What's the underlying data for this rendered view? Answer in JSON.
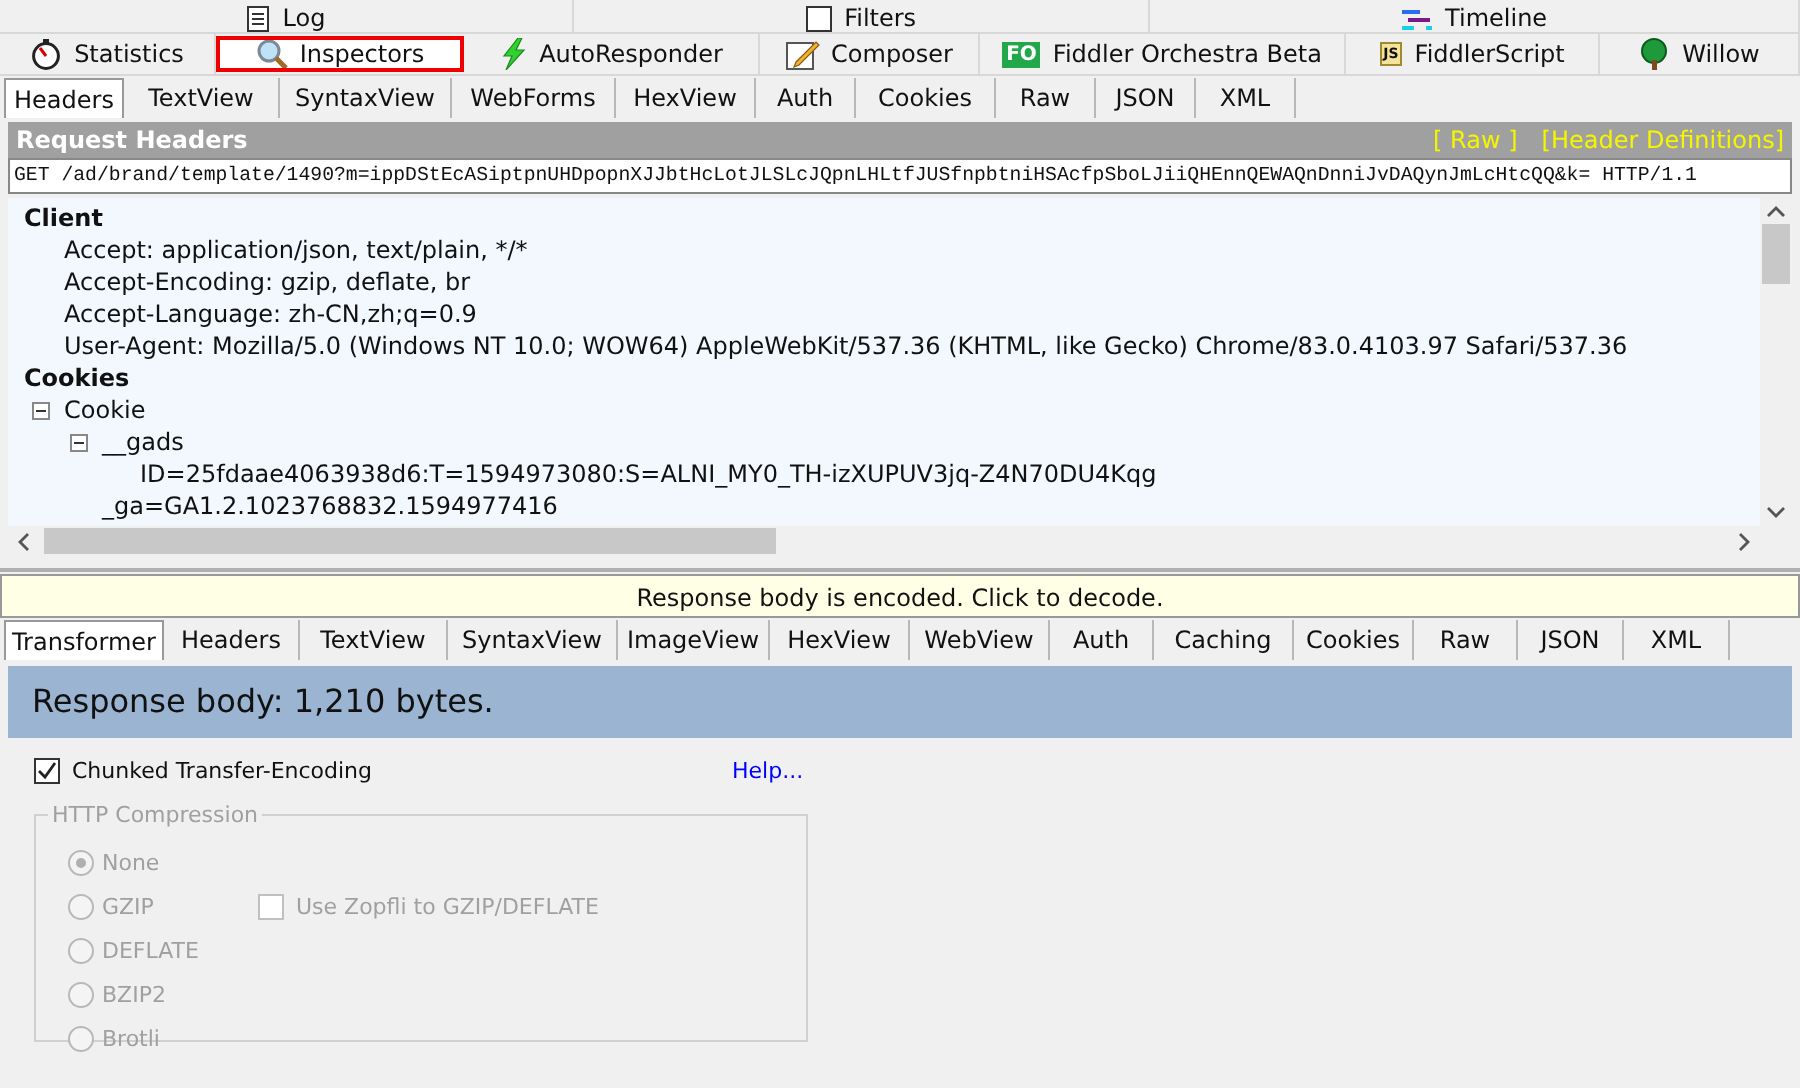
{
  "top_tabs": [
    {
      "label": "Log"
    },
    {
      "label": "Filters"
    },
    {
      "label": "Timeline"
    }
  ],
  "main_tabs": [
    {
      "label": "Statistics",
      "selected": false
    },
    {
      "label": "Inspectors",
      "selected": true
    },
    {
      "label": "AutoResponder",
      "selected": false
    },
    {
      "label": "Composer",
      "selected": false
    },
    {
      "label": "Fiddler Orchestra Beta",
      "badge": "FO",
      "selected": false
    },
    {
      "label": "FiddlerScript",
      "badge": "JS",
      "selected": false
    },
    {
      "label": "Willow",
      "selected": false
    }
  ],
  "request_tabs": [
    {
      "label": "Headers",
      "selected": true
    },
    {
      "label": "TextView",
      "selected": false
    },
    {
      "label": "SyntaxView",
      "selected": false
    },
    {
      "label": "WebForms",
      "selected": false
    },
    {
      "label": "HexView",
      "selected": false
    },
    {
      "label": "Auth",
      "selected": false
    },
    {
      "label": "Cookies",
      "selected": false
    },
    {
      "label": "Raw",
      "selected": false
    },
    {
      "label": "JSON",
      "selected": false
    },
    {
      "label": "XML",
      "selected": false
    }
  ],
  "request_headers": {
    "title": "Request Headers",
    "links": [
      "[ Raw ]",
      "[Header Definitions]"
    ],
    "request_line": "GET /ad/brand/template/1490?m=ippDStEcASiptpnUHDpopnXJJbtHcLotJLSLcJQpnLHLtfJUSfnpbtniHSAcfpSboLJiiQHEnnQEWAQnDnniJvDAQynJmLcHtcQQ&k= HTTP/1.1",
    "sections": [
      {
        "title": "Client",
        "items": [
          {
            "label": "Accept: application/json, text/plain, */*"
          },
          {
            "label": "Accept-Encoding: gzip, deflate, br"
          },
          {
            "label": "Accept-Language: zh-CN,zh;q=0.9"
          },
          {
            "label": "User-Agent: Mozilla/5.0 (Windows NT 10.0; WOW64) AppleWebKit/537.36 (KHTML, like Gecko) Chrome/83.0.4103.97 Safari/537.36"
          }
        ]
      },
      {
        "title": "Cookies",
        "items": [
          {
            "label": "Cookie",
            "expanded": true,
            "children": [
              {
                "label": "__gads",
                "expanded": true,
                "children": [
                  {
                    "label": "ID=25fdaae4063938d6:T=1594973080:S=ALNI_MY0_TH-izXUPUV3jq-Z4N70DU4Kqg"
                  }
                ]
              },
              {
                "label": "_ga=GA1.2.1023768832.1594977416"
              }
            ]
          }
        ]
      }
    ]
  },
  "decode_bar": "Response body is encoded. Click to decode.",
  "response_tabs": [
    {
      "label": "Transformer",
      "selected": true
    },
    {
      "label": "Headers",
      "selected": false
    },
    {
      "label": "TextView",
      "selected": false
    },
    {
      "label": "SyntaxView",
      "selected": false
    },
    {
      "label": "ImageView",
      "selected": false
    },
    {
      "label": "HexView",
      "selected": false
    },
    {
      "label": "WebView",
      "selected": false
    },
    {
      "label": "Auth",
      "selected": false
    },
    {
      "label": "Caching",
      "selected": false
    },
    {
      "label": "Cookies",
      "selected": false
    },
    {
      "label": "Raw",
      "selected": false
    },
    {
      "label": "JSON",
      "selected": false
    },
    {
      "label": "XML",
      "selected": false
    }
  ],
  "response_body": "Response body: 1,210 bytes.",
  "chunked": {
    "label": "Chunked Transfer-Encoding",
    "checked": true
  },
  "help_link": "Help...",
  "compression": {
    "title": "HTTP Compression",
    "disabled": true,
    "options": [
      {
        "label": "None",
        "selected": true
      },
      {
        "label": "GZIP",
        "selected": false
      },
      {
        "label": "DEFLATE",
        "selected": false
      },
      {
        "label": "BZIP2",
        "selected": false
      },
      {
        "label": "Brotli",
        "selected": false
      }
    ],
    "zopfli": {
      "label": "Use Zopfli to GZIP/DEFLATE",
      "checked": false
    }
  }
}
